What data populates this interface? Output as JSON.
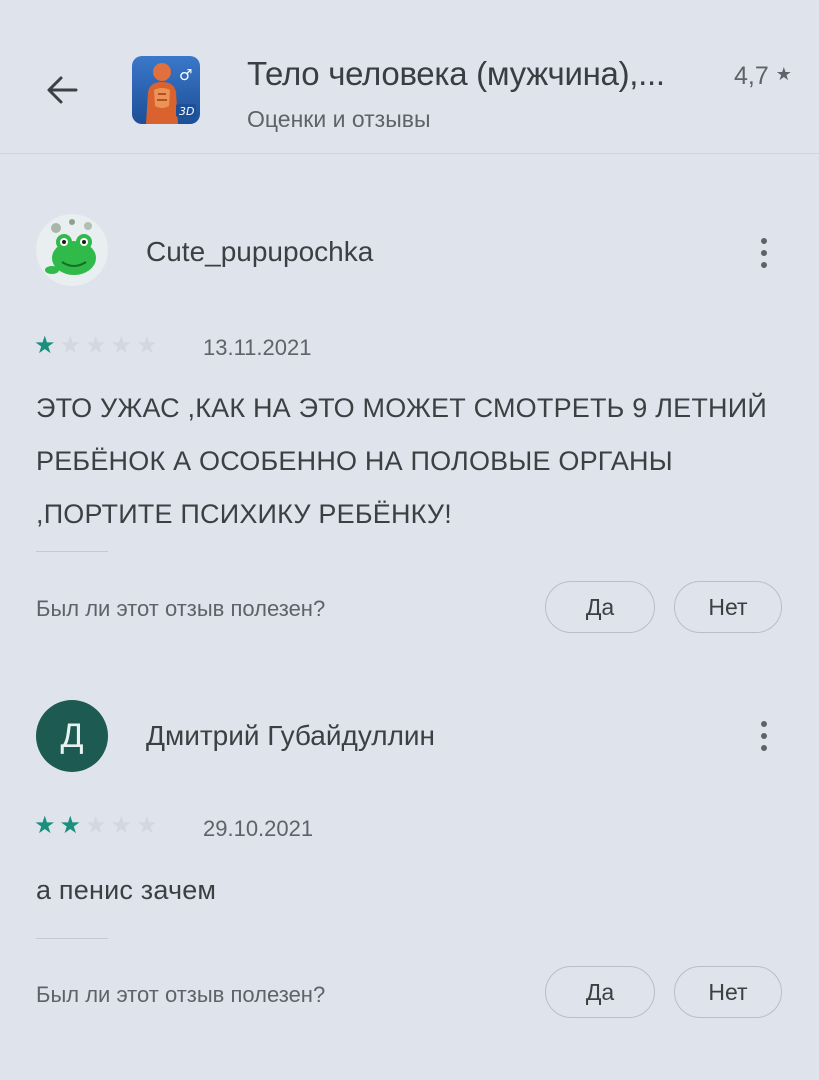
{
  "header": {
    "title": "Тело человека (мужчина),...",
    "rating": "4,7",
    "rating_star": "★",
    "subtitle": "Оценки и отзывы"
  },
  "icons": {
    "back": "arrow-back-icon",
    "app": "app-icon-3d-anatomy",
    "more": "more-vert-icon",
    "star": "star-icon"
  },
  "colors": {
    "background": "#dfe3ec",
    "star_filled": "#1a8f7d",
    "star_empty": "#d3d7df",
    "avatar_letter_bg": "#1d5a52"
  },
  "reviews": [
    {
      "author": "Cute_pupupochka",
      "rating": 1,
      "max_rating": 5,
      "date": "13.11.2021",
      "text": "ЭТО УЖАС ,КАК НА ЭТО МОЖЕТ СМОТРЕТЬ 9 ЛЕТНИЙ РЕБЁНОК А ОСОБЕННО НА ПОЛОВЫЕ ОРГАНЫ ,ПОРТИТЕ ПСИХИКУ РЕБЁНКУ!",
      "helpful_question": "Был ли этот отзыв полезен?",
      "yes_label": "Да",
      "no_label": "Нет"
    },
    {
      "author": "Дмитрий Губайдуллин",
      "avatar_letter": "Д",
      "rating": 2,
      "max_rating": 5,
      "date": "29.10.2021",
      "text": "а пенис зачем",
      "helpful_question": "Был ли этот отзыв полезен?",
      "yes_label": "Да",
      "no_label": "Нет"
    }
  ]
}
